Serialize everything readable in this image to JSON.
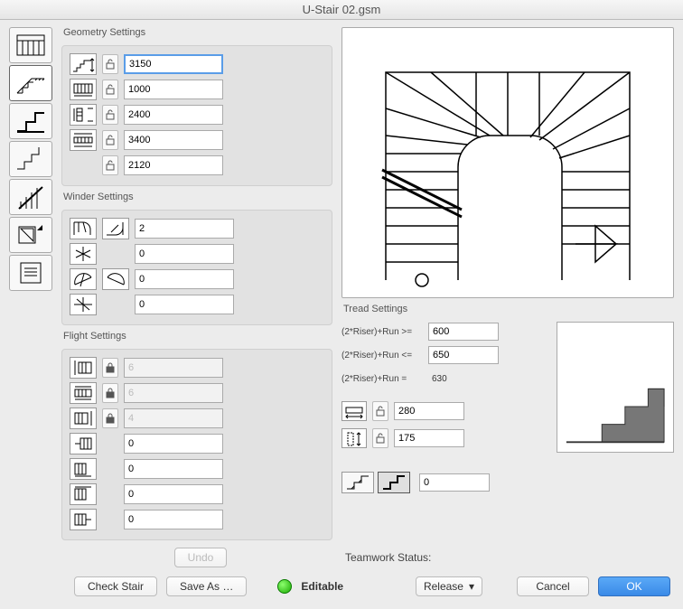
{
  "title": "U-Stair 02.gsm",
  "sections": {
    "geometry": "Geometry Settings",
    "winder": "Winder Settings",
    "flight": "Flight Settings",
    "tread": "Tread Settings"
  },
  "geometry": {
    "r1": "3150",
    "r2": "1000",
    "r3": "2400",
    "r4": "3400",
    "r5": "2120"
  },
  "winder": {
    "r1": "2",
    "r2": "0",
    "r3": "0",
    "r4": "0"
  },
  "flight": {
    "r1": "6",
    "r2": "6",
    "r3": "4",
    "r4": "0",
    "r5": "0",
    "r6": "0",
    "r7": "0"
  },
  "tread": {
    "ge_label": "(2*Riser)+Run >=",
    "ge_val": "600",
    "le_label": "(2*Riser)+Run <=",
    "le_val": "650",
    "eq_label": "(2*Riser)+Run =",
    "eq_val": "630",
    "run": "280",
    "rise": "175",
    "toggle_val": "0"
  },
  "footer": {
    "undo": "Undo",
    "check": "Check Stair",
    "saveas": "Save As …",
    "tw_label": "Teamwork Status:",
    "editable": "Editable",
    "release": "Release",
    "cancel": "Cancel",
    "ok": "OK"
  }
}
